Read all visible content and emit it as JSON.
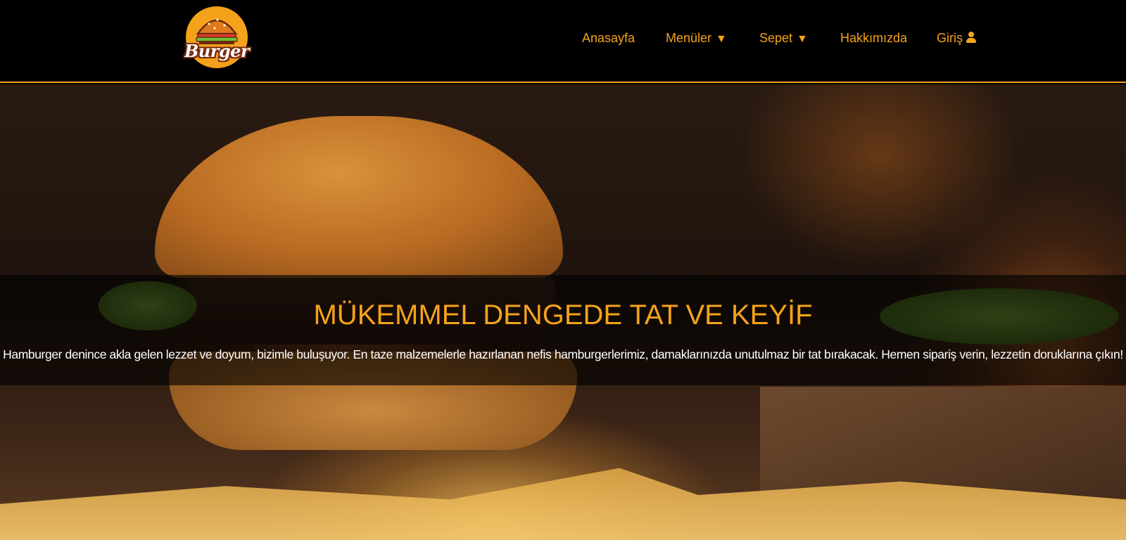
{
  "brand": {
    "logo_text": "Burger",
    "accent_color": "#f5a21b"
  },
  "nav": {
    "items": [
      {
        "label": "Anasayfa",
        "icon": null
      },
      {
        "label": "Menüler",
        "icon": "caret-down-icon",
        "glyph": "▼"
      },
      {
        "label": "Sepet",
        "icon": "caret-down-icon",
        "glyph": "▼"
      },
      {
        "label": "Hakkımızda",
        "icon": null
      },
      {
        "label": "Giriş",
        "icon": "user-icon"
      }
    ]
  },
  "hero": {
    "title": "MÜKEMMEL DENGEDE TAT VE KEYİF",
    "text": "Hamburger denince akla gelen lezzet ve doyum, bizimle buluşuyor. En taze malzemelerle hazırlanan nefis hamburgerlerimiz, damaklarınızda unutulmaz bir tat bırakacak. Hemen sipariş verin, lezzetin doruklarına çıkın!",
    "background_image": "burger-and-fries-photo"
  }
}
